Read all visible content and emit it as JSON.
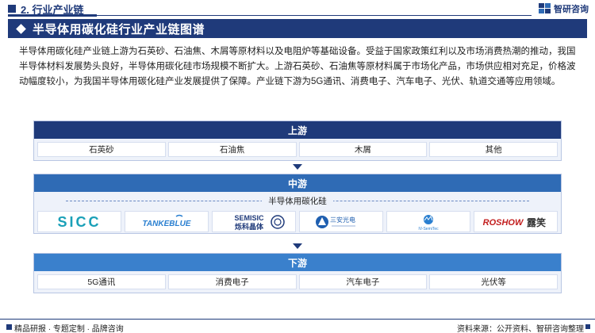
{
  "header": {
    "section_title": "2. 行业产业链",
    "brand_name": "智研咨询"
  },
  "banner": {
    "title": "半导体用碳化硅行业产业链图谱"
  },
  "paragraph": "半导体用碳化硅产业链上游为石英砂、石油焦、木屑等原材料以及电阻炉等基础设备。受益于国家政策红利以及市场消费热潮的推动，我国半导体材料发展势头良好，半导体用碳化硅市场规模不断扩大。上游石英砂、石油焦等原材料属于市场化产品，市场供应相对充足，价格波动幅度较小，为我国半导体用碳化硅产业发展提供了保障。产业链下游为5G通讯、消费电子、汽车电子、光伏、轨道交通等应用领域。",
  "upstream": {
    "label": "上游",
    "items": [
      "石英砂",
      "石油焦",
      "木屑",
      "其他"
    ]
  },
  "midstream": {
    "label": "中游",
    "subtitle": "半导体用碳化硅",
    "logos": [
      {
        "name": "SICC",
        "color": "#1aa0b8"
      },
      {
        "name": "TANKEBLUE",
        "color": "#2a7fd0"
      },
      {
        "name": "SEMISIC",
        "sub": "烁科晶体",
        "color": "#1f3a7a"
      },
      {
        "name": "三安光电",
        "color": "#1f5fb0"
      },
      {
        "name": "IV-SemiTec",
        "color": "#2a7fd0"
      },
      {
        "name": "ROSHOW",
        "sub": "露笑",
        "color": "#c21d1d"
      }
    ]
  },
  "downstream": {
    "label": "下游",
    "items": [
      "5G通讯",
      "消费电子",
      "汽车电子",
      "光伏等"
    ]
  },
  "footer": {
    "left": "精品研报 · 专题定制 · 品牌咨询",
    "right": "资料来源：公开资料、智研咨询整理"
  }
}
